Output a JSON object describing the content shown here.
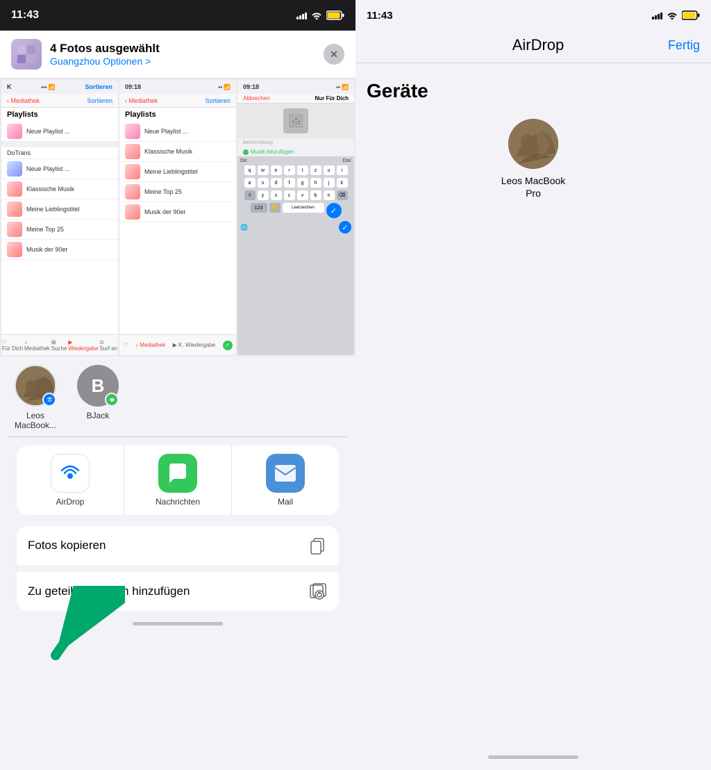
{
  "left": {
    "statusBar": {
      "time": "11:43"
    },
    "shareHeader": {
      "title": "4 Fotos ausgewählt",
      "location": "Guangzhou",
      "options": "Optionen >",
      "closeLabel": "×"
    },
    "preview": {
      "screen1": {
        "status": "09:18",
        "navLeft": "Mediathek",
        "navRight": "Sortieren",
        "title": "Playlists",
        "items": [
          {
            "label": "Neue Playlist ...",
            "color": "red"
          },
          {
            "label": "Klassische Musik",
            "color": "red"
          },
          {
            "label": "Meine Lieblingstitel",
            "color": "red"
          },
          {
            "label": "Meine Top 25",
            "color": "red"
          },
          {
            "label": "Musik der 90er",
            "color": "red"
          }
        ],
        "bottomItems": [
          "",
          "K. Wiedergabe",
          ""
        ]
      },
      "screen2": {
        "status": "09:18",
        "navLeft": "Abbrechen",
        "navTitle": "Nur Für Dich",
        "descLabel": "Beschreibung",
        "musicBtn": "Musik hinzufügen",
        "kbdRows": [
          [
            "q",
            "w",
            "e",
            "r",
            "t",
            "z",
            "u",
            "i"
          ],
          [
            "a",
            "s",
            "d",
            "f",
            "g",
            "h",
            "j",
            "k"
          ],
          [
            "x",
            "c",
            "v",
            "b",
            "n"
          ],
          [
            "123",
            "Leerzeichen"
          ]
        ]
      }
    },
    "airdropRow": {
      "items": [
        {
          "id": "leos-macbook",
          "name": "Leos\nMacBook...",
          "badge": "airdrop"
        },
        {
          "id": "bjack",
          "name": "BJack",
          "initial": "B",
          "badge": "messages"
        }
      ]
    },
    "appRow": {
      "apps": [
        {
          "id": "airdrop",
          "name": "AirDrop",
          "emoji": "📡"
        },
        {
          "id": "nachrichten",
          "name": "Nachrichten",
          "emoji": "💬"
        },
        {
          "id": "mail",
          "name": "Mail",
          "emoji": "✉️"
        }
      ]
    },
    "actionRows": [
      {
        "id": "fotos-kopieren",
        "label": "Fotos kopieren",
        "icon": "⿻"
      },
      {
        "id": "zu-album",
        "label": "Zu geteiltem Album hinzufügen",
        "icon": "👤"
      }
    ]
  },
  "right": {
    "statusBar": {
      "time": "11:43"
    },
    "nav": {
      "title": "AirDrop",
      "doneLabel": "Fertig"
    },
    "geraeteTitle": "Geräte",
    "devices": [
      {
        "id": "leos-macbook-pro",
        "name": "Leos MacBook\nPro"
      }
    ]
  }
}
